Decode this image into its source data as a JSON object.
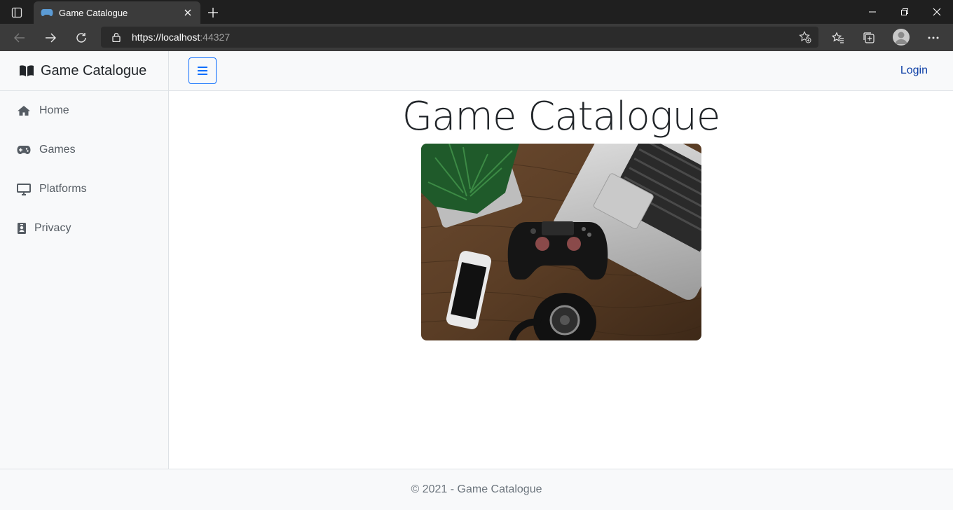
{
  "browser": {
    "tab_title": "Game Catalogue",
    "url_host": "https://localhost",
    "url_port": ":44327"
  },
  "sidebar": {
    "brand": "Game Catalogue",
    "items": [
      {
        "label": "Home",
        "icon": "home-icon"
      },
      {
        "label": "Games",
        "icon": "gamepad-icon"
      },
      {
        "label": "Platforms",
        "icon": "desktop-icon"
      },
      {
        "label": "Privacy",
        "icon": "id-badge-icon"
      }
    ]
  },
  "topbar": {
    "login": "Login"
  },
  "main": {
    "title": "Game Catalogue",
    "hero_alt": "Game Catalogue"
  },
  "footer": {
    "text": "© 2021 - Game Catalogue"
  },
  "colors": {
    "accent": "#0d6efd",
    "link": "#0d3fa6",
    "sidebar_bg": "#f8f9fa"
  }
}
